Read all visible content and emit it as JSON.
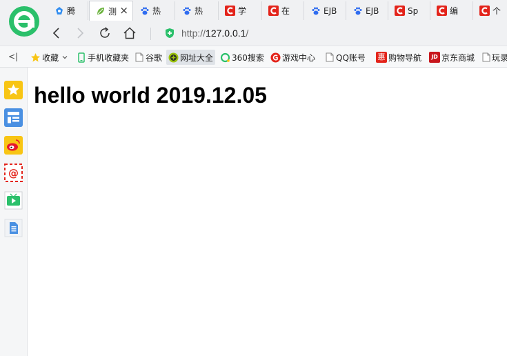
{
  "colors": {
    "brand_green": "#2bc06b",
    "baidu_blue": "#2f6cf0",
    "csdn_red": "#e3241b",
    "spring_green": "#6cb33f",
    "star_yellow": "#f8c514",
    "weibo_red": "#e6162d"
  },
  "browser": {
    "logo_icon": "browser-e-logo-icon",
    "tabs": [
      {
        "title": "腾",
        "icon": "tencent-icon",
        "active": false
      },
      {
        "title": "测",
        "icon": "spring-leaf-icon",
        "active": true
      },
      {
        "title": "热",
        "icon": "baidu-paw-icon",
        "active": false
      },
      {
        "title": "热",
        "icon": "baidu-paw-icon",
        "active": false
      },
      {
        "title": "学",
        "icon": "csdn-icon",
        "active": false
      },
      {
        "title": "在",
        "icon": "csdn-icon",
        "active": false
      },
      {
        "title": "EJB",
        "icon": "baidu-paw-icon",
        "active": false
      },
      {
        "title": "EJB",
        "icon": "baidu-paw-icon",
        "active": false
      },
      {
        "title": "Sp",
        "icon": "csdn-icon",
        "active": false
      },
      {
        "title": "编",
        "icon": "csdn-icon",
        "active": false
      },
      {
        "title": "个",
        "icon": "csdn-icon",
        "active": false
      }
    ],
    "tab_close_glyph": "×",
    "address": {
      "scheme": "http://",
      "host": "127.0.0.1",
      "path": "/"
    }
  },
  "bookmarks": {
    "collapse_glyph": "<|",
    "items": [
      {
        "label": "收藏",
        "icon": "star-icon"
      },
      {
        "label": "手机收藏夹",
        "icon": "phone-icon"
      },
      {
        "label": "谷歌",
        "icon": "page-icon"
      },
      {
        "label": "网址大全",
        "icon": "plus-circle-icon"
      },
      {
        "label": "360搜索",
        "icon": "360-search-icon"
      },
      {
        "label": "游戏中心",
        "icon": "game-icon"
      },
      {
        "label": "QQ账号",
        "icon": "page-icon"
      },
      {
        "label": "购物导航",
        "icon": "hui-icon"
      },
      {
        "label": "京东商城",
        "icon": "jd-icon"
      },
      {
        "label": "玩录",
        "icon": "page-icon"
      }
    ],
    "hui_glyph": "惠",
    "jd_glyph": "JD"
  },
  "sidebar": {
    "items": [
      {
        "icon": "favorites-star-icon"
      },
      {
        "icon": "news-list-icon"
      },
      {
        "icon": "weibo-icon"
      },
      {
        "icon": "mail-at-icon"
      },
      {
        "icon": "video-play-icon"
      },
      {
        "icon": "notes-document-icon"
      }
    ],
    "at_glyph": "@"
  },
  "page": {
    "heading": "hello world 2019.12.05"
  }
}
